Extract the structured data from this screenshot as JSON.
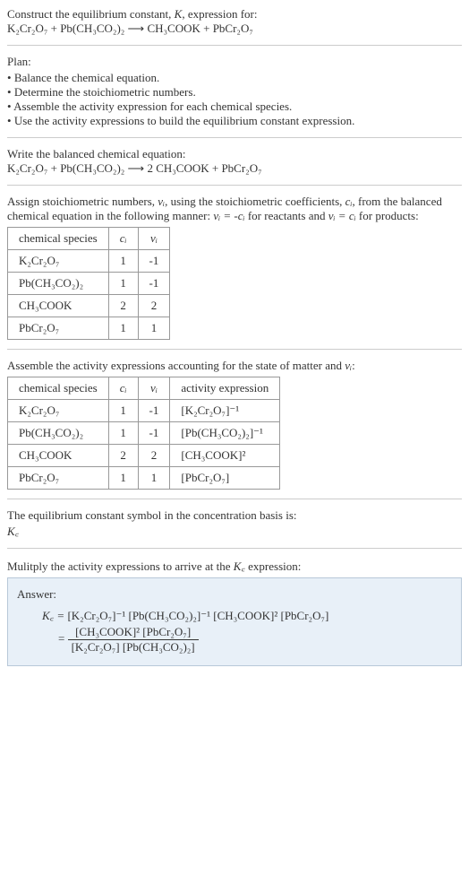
{
  "header": {
    "construct": "Construct the equilibrium constant, ",
    "K": "K",
    "expression_for": ", expression for:",
    "reaction_unbalanced": "K₂Cr₂O₇ + Pb(CH₃CO₂)₂  ⟶  CH₃COOK + PbCr₂O₇"
  },
  "plan": {
    "title": "Plan:",
    "items": [
      "Balance the chemical equation.",
      "Determine the stoichiometric numbers.",
      "Assemble the activity expression for each chemical species.",
      "Use the activity expressions to build the equilibrium constant expression."
    ]
  },
  "balanced": {
    "intro": "Write the balanced chemical equation:",
    "reaction": "K₂Cr₂O₇ + Pb(CH₃CO₂)₂  ⟶  2 CH₃COOK + PbCr₂O₇"
  },
  "stoich": {
    "intro_1": "Assign stoichiometric numbers, ",
    "nu_i": "νᵢ",
    "intro_2": ", using the stoichiometric coefficients, ",
    "c_i": "cᵢ",
    "intro_3": ", from the balanced chemical equation in the following manner: ",
    "eq1": "νᵢ = -cᵢ",
    "intro_4": " for reactants and ",
    "eq2": "νᵢ = cᵢ",
    "intro_5": " for products:",
    "table": {
      "headers": [
        "chemical species",
        "cᵢ",
        "νᵢ"
      ],
      "rows": [
        {
          "species": "K₂Cr₂O₇",
          "c": "1",
          "nu": "-1"
        },
        {
          "species": "Pb(CH₃CO₂)₂",
          "c": "1",
          "nu": "-1"
        },
        {
          "species": "CH₃COOK",
          "c": "2",
          "nu": "2"
        },
        {
          "species": "PbCr₂O₇",
          "c": "1",
          "nu": "1"
        }
      ]
    }
  },
  "activity": {
    "intro_1": "Assemble the activity expressions accounting for the state of matter and ",
    "nu_i": "νᵢ",
    "intro_2": ":",
    "table": {
      "headers": [
        "chemical species",
        "cᵢ",
        "νᵢ",
        "activity expression"
      ],
      "rows": [
        {
          "species": "K₂Cr₂O₇",
          "c": "1",
          "nu": "-1",
          "act": "[K₂Cr₂O₇]⁻¹"
        },
        {
          "species": "Pb(CH₃CO₂)₂",
          "c": "1",
          "nu": "-1",
          "act": "[Pb(CH₃CO₂)₂]⁻¹"
        },
        {
          "species": "CH₃COOK",
          "c": "2",
          "nu": "2",
          "act": "[CH₃COOK]²"
        },
        {
          "species": "PbCr₂O₇",
          "c": "1",
          "nu": "1",
          "act": "[PbCr₂O₇]"
        }
      ]
    }
  },
  "kc_symbol": {
    "intro": "The equilibrium constant symbol in the concentration basis is:",
    "symbol": "K꜀"
  },
  "final": {
    "intro_1": "Mulitply the activity expressions to arrive at the ",
    "kc": "K꜀",
    "intro_2": " expression:",
    "answer_label": "Answer:",
    "kc_eq": "K꜀ = ",
    "line1": "[K₂Cr₂O₇]⁻¹ [Pb(CH₃CO₂)₂]⁻¹ [CH₃COOK]² [PbCr₂O₇]",
    "eq_sign": "= ",
    "numerator": "[CH₃COOK]² [PbCr₂O₇]",
    "denominator": "[K₂Cr₂O₇] [Pb(CH₃CO₂)₂]"
  }
}
